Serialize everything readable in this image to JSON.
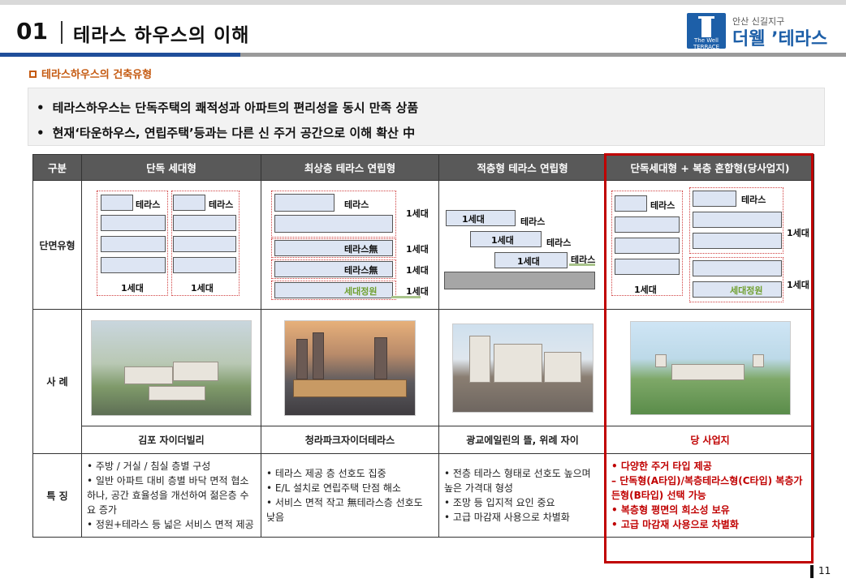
{
  "header": {
    "page_no": "01",
    "title": "테라스 하우스의 이해",
    "logo_sub": "안산 신길지구",
    "logo_main": "더웰 ’테라스",
    "logo_badge": "The Well TERRACE",
    "colors": {
      "brand": "#1d5fa8",
      "accent": "#c55a11",
      "highlight": "#c00000"
    }
  },
  "section": {
    "icon": "square-icon",
    "label": "테라스하우스의 건축유형"
  },
  "summary": [
    "테라스하우스는 단독주택의 쾌적성과 아파트의 편리성을 동시 만족 상품",
    "현재‘타운하우스, 연립주택’등과는 다른 신 주거 공간으로 이해 확산 中"
  ],
  "table": {
    "headers": [
      "구분",
      "단독 세대형",
      "최상층 테라스 연립형",
      "적층형 테라스 연립형",
      "단독세대형 + 복층 혼합형(당사업지)"
    ],
    "row_labels": [
      "단면유형",
      "사  례",
      "",
      "특  징"
    ],
    "diagrams": {
      "col1": {
        "terrace_left": "테라스",
        "terrace_right": "테라스",
        "unit_left": "1세대",
        "unit_right": "1세대"
      },
      "col2": {
        "terrace": "테라스",
        "terrace_none_1": "테라스無",
        "terrace_none_2": "테라스無",
        "garden": "세대정원",
        "units": [
          "1세대",
          "1세대",
          "1세대",
          "1세대"
        ]
      },
      "col3": {
        "units": [
          "1세대",
          "1세대",
          "1세대"
        ],
        "terraces": [
          "테라스",
          "테라스",
          "테라스"
        ]
      },
      "col4": {
        "terrace_left": "테라스",
        "terrace_right": "테라스",
        "unit_left": "1세대",
        "unit_right_1": "1세대",
        "unit_right_2": "1세대",
        "garden": "세대정원"
      }
    },
    "names": [
      "김포 자이더빌리",
      "청라파크자이더테라스",
      "광교에일린의 뜰, 위례 자이",
      "당 사업지"
    ],
    "features": [
      [
        "주방 / 거실 / 침실 층별 구성",
        "일반 아파트 대비 층별 바닥 면적 협소하나, 공간 효율성을 개선하여 젊은층 수요 증가",
        "정원+테라스 등 넓은 서비스 면적 제공"
      ],
      [
        "테라스 제공 층 선호도 집중",
        "E/L 설치로 연립주택 단점 해소",
        "서비스 면적 작고 無테라스층 선호도 낮음"
      ],
      [
        "전층 테라스 형태로 선호도 높으며 높은 가격대 형성",
        "조망 등 입지적 요인 중요",
        "고급 마감재 사용으로 차별화"
      ],
      [
        "다양한 주거 타입 제공",
        "단독형(A타입)/복층테라스형(C타입) 복층가든형(B타입) 선택 가능",
        "복층형 평면의 희소성 보유",
        "고급 마감재 사용으로 차별화"
      ]
    ],
    "feature_markers": [
      "•",
      "•",
      "•",
      "–",
      "•",
      "•"
    ]
  },
  "footer": {
    "page_number": "11"
  }
}
